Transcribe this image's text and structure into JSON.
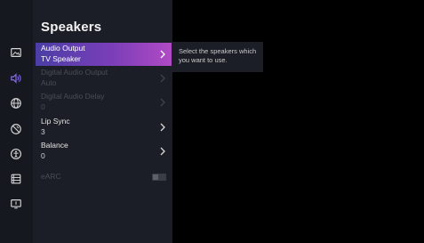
{
  "panel": {
    "title": "Speakers",
    "items": [
      {
        "label": "Audio Output",
        "value": "TV Speaker"
      },
      {
        "label": "Digital Audio Output",
        "value": "Auto"
      },
      {
        "label": "Digital Audio Delay",
        "value": "0"
      },
      {
        "label": "Lip Sync",
        "value": "3"
      },
      {
        "label": "Balance",
        "value": "0"
      },
      {
        "label": "eARC",
        "value": ""
      }
    ]
  },
  "tooltip": {
    "text": "Select the speakers which you want to use."
  },
  "sidebar": {
    "icons": [
      "picture-icon",
      "sound-icon",
      "network-icon",
      "channel-icon",
      "accessibility-icon",
      "system-icon",
      "support-icon"
    ]
  },
  "colors": {
    "accent_start": "#4a3ea6",
    "accent_end": "#b04ac4",
    "active_icon": "#8a6ff0"
  }
}
